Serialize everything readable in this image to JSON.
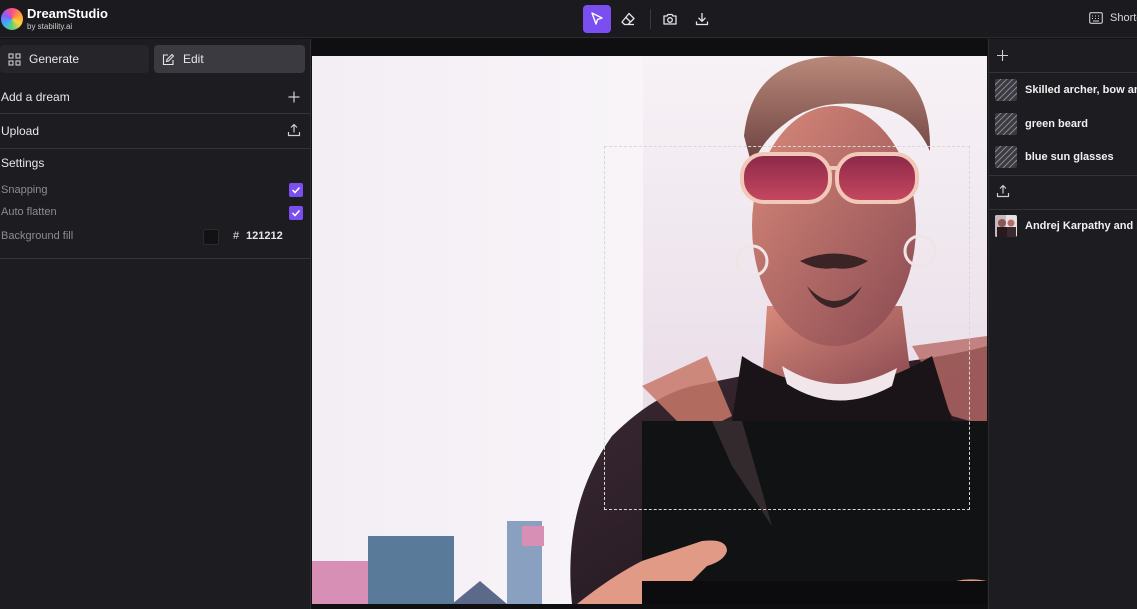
{
  "app": {
    "name": "DreamStudio",
    "byline": "by stability.ai"
  },
  "toolbar": {
    "tools": [
      {
        "icon": "cursor-select-icon",
        "active": true
      },
      {
        "icon": "eraser-icon",
        "active": false
      },
      {
        "icon": "camera-icon",
        "active": false
      },
      {
        "icon": "download-icon",
        "active": false
      }
    ],
    "shortcuts_label": "Shortcuts"
  },
  "left_panel": {
    "generate_label": "Generate",
    "edit_label": "Edit",
    "add_dream_label": "Add a dream",
    "upload_label": "Upload",
    "settings": {
      "title": "Settings",
      "snapping_label": "Snapping",
      "snapping_checked": true,
      "auto_flatten_label": "Auto flatten",
      "auto_flatten_checked": true,
      "background_fill_label": "Background fill",
      "background_fill_hash": "#",
      "background_fill_value": "121212"
    }
  },
  "right_panel": {
    "prompts": [
      "Skilled archer, bow and arrow",
      "green beard",
      "blue sun glasses"
    ],
    "images": [
      "Andrej Karpathy and Lex"
    ]
  },
  "colors": {
    "accent": "#7b4ef0",
    "panel": "#1c1c21",
    "canvas_bg": "#121212"
  }
}
